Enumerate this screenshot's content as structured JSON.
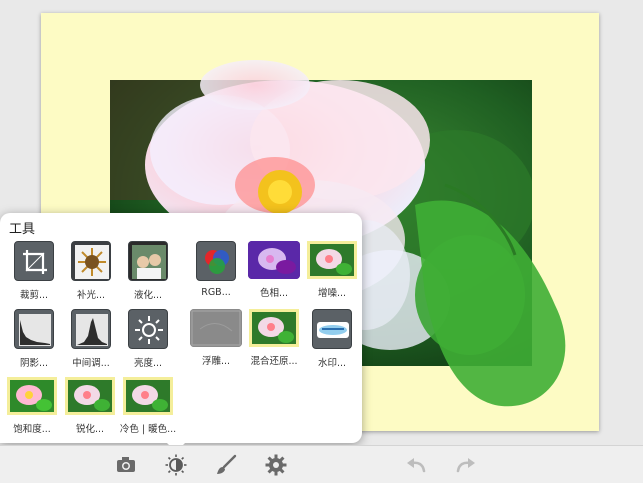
{
  "tool_panel": {
    "title": "工具",
    "tools": [
      {
        "label": "裁剪..."
      },
      {
        "label": "补光..."
      },
      {
        "label": "液化..."
      },
      {
        "label": "RGB..."
      },
      {
        "label": "色相..."
      },
      {
        "label": "增噪..."
      },
      {
        "label": "阴影..."
      },
      {
        "label": "中间调..."
      },
      {
        "label": "亮度..."
      },
      {
        "label": "浮雕..."
      },
      {
        "label": "混合还原..."
      },
      {
        "label": "水印..."
      },
      {
        "label": "饱和度..."
      },
      {
        "label": "锐化..."
      },
      {
        "label": "冷色 | 暖色..."
      }
    ]
  },
  "toolbar": {
    "icons": [
      "camera-icon",
      "brightness-icon",
      "brush-icon",
      "gear-icon",
      "undo-icon",
      "redo-icon"
    ]
  },
  "colors": {
    "frame_bg": "#fdfbc4",
    "panel_bg": "#ffffff",
    "toolbar_bg": "#efefef"
  }
}
